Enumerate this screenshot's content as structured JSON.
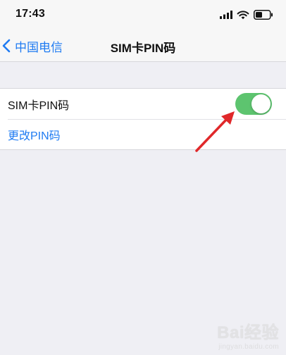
{
  "status_bar": {
    "time": "17:43"
  },
  "nav": {
    "back_label": "中国电信",
    "title": "SIM卡PIN码"
  },
  "settings": {
    "pin_toggle_label": "SIM卡PIN码",
    "pin_toggle_on": true,
    "change_pin_label": "更改PIN码"
  },
  "colors": {
    "accent_blue": "#1f7bf2",
    "toggle_on_green": "#5dc46f",
    "annotation_red": "#e0282a"
  },
  "watermark": {
    "brand": "Bai经验",
    "url": "jingyan.baidu.com"
  }
}
